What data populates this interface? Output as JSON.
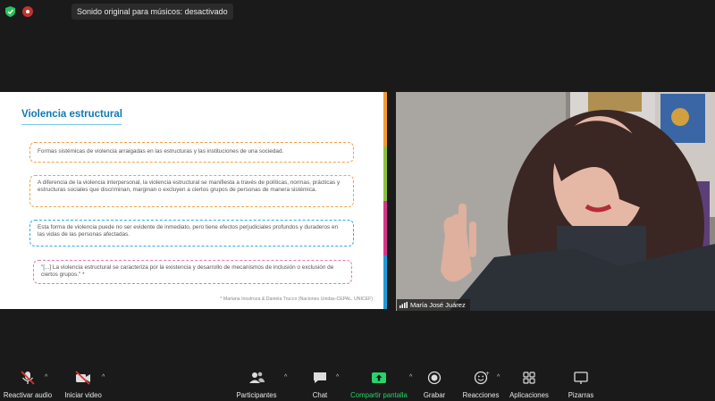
{
  "topbar": {
    "notification": "Sonido original para músicos: desactivado"
  },
  "slide": {
    "title": "Violencia estructural",
    "boxes": [
      "Formas sistémicas de violencia arraigadas en las estructuras y las instituciones de una sociedad.",
      "A diferencia de la violencia interpersonal, la violencia estructural se manifiesta a través de políticas, normas, prácticas y estructuras sociales que discriminan, marginan o excluyen a ciertos grupos de personas de manera sistémica.",
      "Esta forma de violencia puede no ser evidente de inmediato, pero tiene efectos perjudiciales profundos y duraderos en las vidas de las personas afectadas.",
      "\"[...] La violencia estructural se caracteriza por la existencia y desarrollo de mecanismos de inclusión o exclusión de ciertos grupos.\" *"
    ],
    "citation": "* Mariana Inostroza & Daniela Trucco (Naciones Unidas-CEPAL, UNICEF)"
  },
  "video": {
    "participant_name": "María José Juárez"
  },
  "toolbar": {
    "unmute": "Reactivar audio",
    "start_video": "Iniciar video",
    "participants": "Participantes",
    "chat": "Chat",
    "share_screen": "Compartir pantalla",
    "record": "Grabar",
    "reactions": "Reacciones",
    "apps": "Aplicaciones",
    "whiteboards": "Pizarras"
  },
  "colors": {
    "share_green": "#27d36a",
    "title_blue": "#0e78b7",
    "muted_red": "#e0312c"
  }
}
